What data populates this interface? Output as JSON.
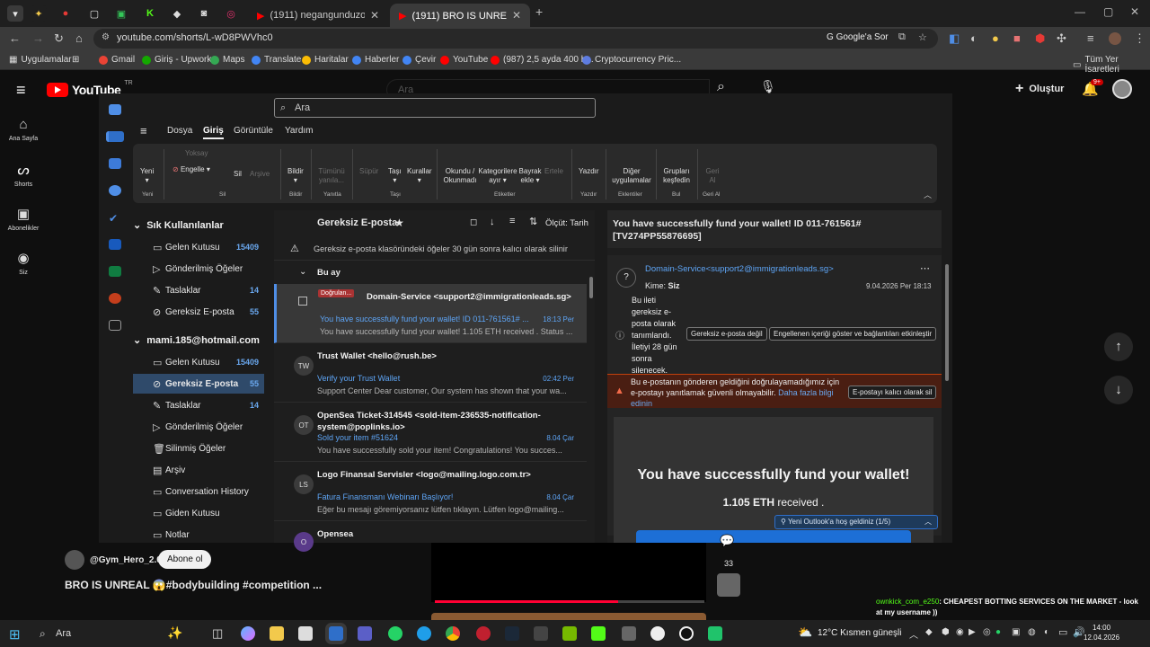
{
  "browser": {
    "tabs": [
      {
        "title": "(1911) negangunduzoyunu - Yo"
      },
      {
        "title": "(1911) BRO IS UNREAL 😱#bod"
      }
    ],
    "url": "youtube.com/shorts/L-wD8PWVhc0",
    "google_lens": "Google'a Sor",
    "bookmarks": [
      "Uygulamalar",
      "Gmail",
      "Giriş - Upwork",
      "Maps",
      "Translate",
      "Haritalar",
      "Haberler",
      "Çevir",
      "YouTube",
      "(987) 2,5 ayda 400 b...",
      "Cryptocurrency Pric..."
    ],
    "all_bookmarks": "Tüm Yer İşaretleri"
  },
  "youtube": {
    "logo": "YouTube",
    "region": "TR",
    "search_placeholder": "Ara",
    "create_label": "Oluştur",
    "notif_badge": "9+",
    "rail": [
      "Ana Sayfa",
      "Shorts",
      "Abonelikler",
      "Siz"
    ],
    "channel": "@Gym_Hero_2.0",
    "subscribe": "Abone ol",
    "video_title": "BRO IS UNREAL 😱#bodybuilding #competition ...",
    "comment_count": "33",
    "chat": {
      "user": "ownkick_com_e250",
      "text": ": CHEAPEST BOTTING SERVICES ON THE MARKET - look at my username ))"
    }
  },
  "outlook": {
    "search_placeholder": "Ara",
    "menu_tabs": [
      "Dosya",
      "Giriş",
      "Görüntüle",
      "Yardım"
    ],
    "ribbon": {
      "new": "Yeni",
      "ignore": "Yoksay",
      "block": "Engelle",
      "delete": "Sil",
      "archive": "Arşive",
      "report": "Bildir",
      "delete_all": "Tümünü yanıla...",
      "sweep": "Süpür",
      "move": "Taşı",
      "rules": "Kurallar",
      "read_unread": "Okundu / Okunmadı",
      "categorize": "Kategorilere ayır",
      "flag": "Bayrak ekle",
      "snooze": "Ertele",
      "print": "Yazdır",
      "other_apps": "Diğer uygulamalar",
      "discover_groups": "Grupları keşfedin",
      "undo": "Geri Al",
      "groups": [
        "Yeni",
        "Sil",
        "Bildir",
        "Yanıtla",
        "Taşı",
        "Etiketler",
        "Yazdır",
        "Eklentiler",
        "Bul",
        "Geri Al"
      ]
    },
    "folders": {
      "favorites_title": "Sık Kullanılanlar",
      "favorites": [
        {
          "name": "Gelen Kutusu",
          "count": "15409",
          "icon": "inbox-icon"
        },
        {
          "name": "Gönderilmiş Öğeler",
          "count": "",
          "icon": "send-icon"
        },
        {
          "name": "Taslaklar",
          "count": "14",
          "icon": "draft-icon"
        },
        {
          "name": "Gereksiz E-posta",
          "count": "55",
          "icon": "junk-icon"
        }
      ],
      "account": "mami.185@hotmail.com",
      "account_folders": [
        {
          "name": "Gelen Kutusu",
          "count": "15409",
          "icon": "inbox-icon"
        },
        {
          "name": "Gereksiz E-posta",
          "count": "55",
          "icon": "junk-icon"
        },
        {
          "name": "Taslaklar",
          "count": "14",
          "icon": "draft-icon"
        },
        {
          "name": "Gönderilmiş Öğeler",
          "count": "",
          "icon": "send-icon"
        },
        {
          "name": "Silinmiş Öğeler",
          "count": "",
          "icon": "trash-icon"
        },
        {
          "name": "Arşiv",
          "count": "",
          "icon": "archive-icon"
        },
        {
          "name": "Conversation History",
          "count": "",
          "icon": "folder-icon"
        },
        {
          "name": "Giden Kutusu",
          "count": "",
          "icon": "outbox-icon"
        },
        {
          "name": "Notlar",
          "count": "",
          "icon": "notes-icon"
        }
      ]
    },
    "list": {
      "title": "Gereksiz E-posta",
      "filter": "Ölçüt: Tarih",
      "notice": "Gereksiz e-posta klasöründeki öğeler 30 gün sonra kalıcı olarak silinir",
      "group": "Bu ay",
      "messages": [
        {
          "badge": "Doğrulan...",
          "avatar": "",
          "sender": "Domain-Service <support2@immigrationleads.sg>",
          "subject": "You have successfully fund your wallet! ID 011-761561# ...",
          "date": "18:13 Per",
          "preview": "You have successfully fund your wallet! 1.105 ETH received . Status ..."
        },
        {
          "badge": "",
          "avatar": "TW",
          "sender": "Trust Wallet <hello@rush.be>",
          "subject": "Verify your Trust Wallet",
          "date": "02:42 Per",
          "preview": "Support Center Dear customer, Our system has shown that your wa..."
        },
        {
          "badge": "",
          "avatar": "OT",
          "sender": "OpenSea Ticket-314545 <sold-item-236535-notification-system@poplinks.io>",
          "subject": "Sold your item #51624",
          "date": "8.04 Çar",
          "preview": "You have successfully sold your item! Congratulations! You succes..."
        },
        {
          "badge": "",
          "avatar": "LS",
          "sender": "Logo Finansal Servisler <logo@mailing.logo.com.tr>",
          "subject": "Fatura Finansmanı Webinarı Başlıyor!",
          "date": "8.04 Çar",
          "preview": "Eğer bu mesajı göremiyorsanız lütfen tıklayın. Lütfen logo@mailing..."
        },
        {
          "badge": "",
          "avatar": "O",
          "sender": "Opensea",
          "subject": "",
          "date": "",
          "preview": ""
        }
      ]
    },
    "reading": {
      "subject": "You have successfully fund your wallet!  ID 011-761561# [TV274PP55876695]",
      "from": "Domain-Service<support2@immigrationleads.sg>",
      "to_label": "Kime:",
      "to": "Siz",
      "date": "9.04.2026 Per 18:13",
      "junk_notice": "Bu ileti gereksiz e-posta olarak tanımlandı. İletiyi 28 gün sonra silenecek.",
      "not_junk": "Gereksiz e-posta değil",
      "show_blocked": "Engellenen içeriği göster ve bağlantıları etkinleştir",
      "warning": "Bu e-postanın gönderen geldiğini doğrulayamadığımız için e-postayı yanıtlamak güvenli olmayabilir.",
      "learn_more": "Daha fazla bilgi edinin",
      "delete_perm": "E-postayı kalıcı olarak sil",
      "body_title": "You have successfully fund your wallet!",
      "body_amount": "1.105 ETH",
      "body_received": " received .",
      "welcome_tip": "Yeni Outlook'a hoş geldiniz (1/5)"
    }
  },
  "taskbar": {
    "search": "Ara",
    "weather": "12°C  Kısmen güneşli",
    "time": "14:00",
    "date": "12.04.2026"
  }
}
